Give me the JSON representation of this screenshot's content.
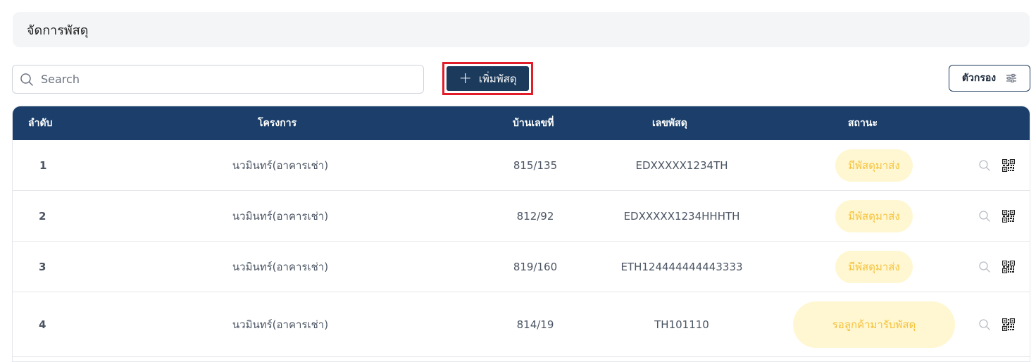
{
  "header": {
    "title": "จัดการพัสดุ"
  },
  "search": {
    "placeholder": "Search",
    "value": "",
    "icon": "search-icon"
  },
  "toolbar": {
    "add_label": "เพิ่มพัสดุ",
    "add_icon": "plus-icon",
    "filter_label": "ตัวกรอง",
    "filter_icon": "sliders-icon"
  },
  "table": {
    "columns": [
      "ลำดับ",
      "โครงการ",
      "บ้านเลขที่",
      "เลขพัสดุ",
      "สถานะ"
    ],
    "rows": [
      {
        "no": "1",
        "project": "นวมินทร์(อาคารเช่า)",
        "house": "815/135",
        "parcel": "EDXXXXX1234TH",
        "status": "มีพัสดุมาส่ง"
      },
      {
        "no": "2",
        "project": "นวมินทร์(อาคารเช่า)",
        "house": "812/92",
        "parcel": "EDXXXXX1234HHHTH",
        "status": "มีพัสดุมาส่ง"
      },
      {
        "no": "3",
        "project": "นวมินทร์(อาคารเช่า)",
        "house": "819/160",
        "parcel": "ETH124444444443333",
        "status": "มีพัสดุมาส่ง"
      },
      {
        "no": "4",
        "project": "นวมินทร์(อาคารเช่า)",
        "house": "814/19",
        "parcel": "TH101110",
        "status": "รอลูกค้ามารับพัสดุ"
      }
    ],
    "row_actions": [
      "search-icon",
      "qr-code-icon"
    ]
  },
  "colors": {
    "header_bg": "#1b3f6a",
    "button_bg": "#1b3a5c",
    "badge_bg": "#fff7d1",
    "badge_text": "#f5c23b",
    "highlight": "#e11d2a"
  }
}
